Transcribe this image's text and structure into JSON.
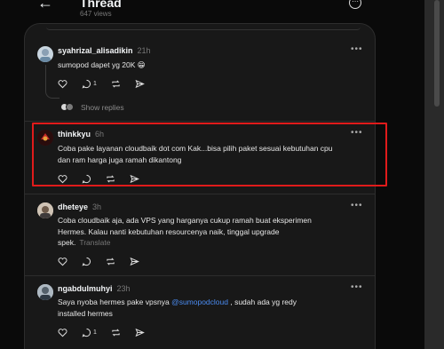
{
  "header": {
    "title": "Thread",
    "views": "647 views"
  },
  "posts": [
    {
      "user": "syahrizal_alisadikin",
      "time": "21h",
      "text": "sumopod dapet yg 20K 😁",
      "reply_count": "1",
      "show_replies": "Show replies"
    },
    {
      "user": "thinkkyu",
      "time": "6h",
      "text_line1": "Coba pake layanan cloudbaik dot com Kak...bisa pilih paket sesuai kebutuhan cpu",
      "text_line2": "dan ram harga juga ramah dikantong"
    },
    {
      "user": "dheteye",
      "time": "3h",
      "text_line1": "Coba cloudbaik aja, ada VPS yang harganya cukup ramah buat eksperimen",
      "text_line2": "Hermes. Kalau nanti kebutuhan resourcenya naik, tinggal upgrade",
      "text_line3": "spek.",
      "translate": "Translate"
    },
    {
      "user": "ngabdulmuhyi",
      "time": "23h",
      "text_pre": "Saya nyoba hermes pake vpsnya ",
      "mention": "@sumopodcloud",
      "text_post": " , sudah ada yg redy",
      "text_line2": "installed hermes",
      "reply_count": "1"
    }
  ],
  "icons": {
    "more": "more-icon",
    "back": "back-arrow-icon",
    "like": "heart-icon",
    "reply": "comment-icon",
    "repost": "repost-icon",
    "share": "send-icon"
  },
  "colors": {
    "highlight": "#e01b1b",
    "mention": "#4a8bf0"
  }
}
